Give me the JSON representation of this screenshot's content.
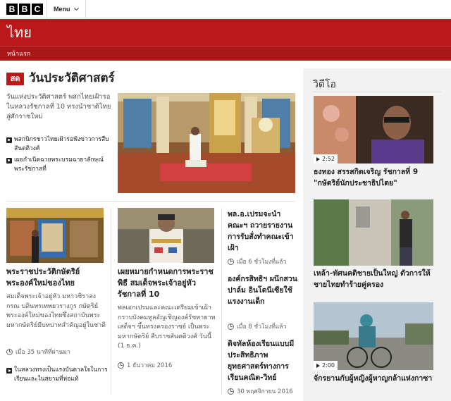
{
  "header": {
    "logo": [
      "B",
      "B",
      "C"
    ],
    "menu_label": "Menu",
    "site_title": "ไทย",
    "nav_home": "หน้าแรก"
  },
  "section": {
    "badge": "สด",
    "title": "วันประวัติศาสตร์"
  },
  "lead": {
    "summary": "วันแห่งประวัติศาสตร์ พสกไทยเฝ้ารอในหลวงรัชกาลที่ 10 ทรงนำชาติไทยสู่ศักราชใหม่",
    "related": [
      {
        "icon": "camera-icon",
        "text": "พสกนิกรชาวไทยเฝ้ารอฟังข่าวการสืบสันตติวงศ์"
      },
      {
        "icon": "camera-icon",
        "text": "เผยกำเนิดฉายพระบรมฉายาลักษณ์พระรัชกาลที่"
      }
    ]
  },
  "stories": [
    {
      "title": "พระราชประวัติกษัตริย์พระองค์ใหม่ของไทย",
      "summary": "สมเด็จพระเจ้าอยู่หัว มหาวชิราลงกรณ บดินทรเทพยวรางกูร กษัตริย์พระองค์ใหม่ของไทยซึ่งสถาบันพระมหากษัตริย์มีบทบาทสำคัญอยู่ในชาติ",
      "time": "เมื่อ 35 นาทีที่ผ่านมา",
      "related": "ในหลวงทรงเป็นแรงบันดาลใจในการเรียนและในสยามที่ห่อแท้"
    },
    {
      "title": "เผยหมายกำหนดการพระราชพิธี สมเด็จพระเจ้าอยู่หัว รัชกาลที่ 10",
      "summary": "พลเอกเปรมและคณะเตรียมเข้าเฝ้า กราบบังคมทูลอัญเชิญองค์รัชทายาท เสด็จฯ ขึ้นทรงครองราชย์ เป็นพระมหากษัตริย์ สืบราชสันตติวงศ์ วันนี้ (1 ธ.ค.)",
      "time": "1 ธันวาคม 2016"
    }
  ],
  "side_stories": [
    {
      "title": "พล.อ.เปรมจะนำคณะฯ ถวายรายงานการรับสั่งทำคณะเข้าเฝ้า",
      "time": "เมื่อ 6 ชั่วโมงที่แล้ว"
    },
    {
      "title": "องค์กรสิทธิฯ ผนึกสวนปาล์ม อินโดนีเซียใช้แรงงานเด็ก",
      "time": "เมื่อ 8 ชั่วโมงที่แล้ว"
    },
    {
      "title": "ดิจทัลห้องเรียนแบบมีประสิทธิภาพยุทธศาสตร์ทางการเรียนคณิต-วิทย์",
      "time": "30 พฤศจิกายน 2016"
    }
  ],
  "videos": {
    "heading": "วิดีโอ",
    "items": [
      {
        "duration": "2:52",
        "title": "ธงทอง สรรสกิตเจริญ รัชกาลที่ 9 \"กษัตริย์นักประชาธิปไตย\""
      },
      {
        "duration": "",
        "title": "เหล้า-ทัศนคติชายเป็นใหญ่ ตัวการให้ชายไทยทำร้ายคู่ครอง"
      },
      {
        "duration": "2:00",
        "title": "จักรยานกับผู้หญิงผู้หาญกล้าแห่งกาซา"
      }
    ]
  },
  "colors": {
    "brand_red": "#bb1919",
    "nav_red": "#a91717",
    "panel_bg": "#f2f2f2"
  }
}
